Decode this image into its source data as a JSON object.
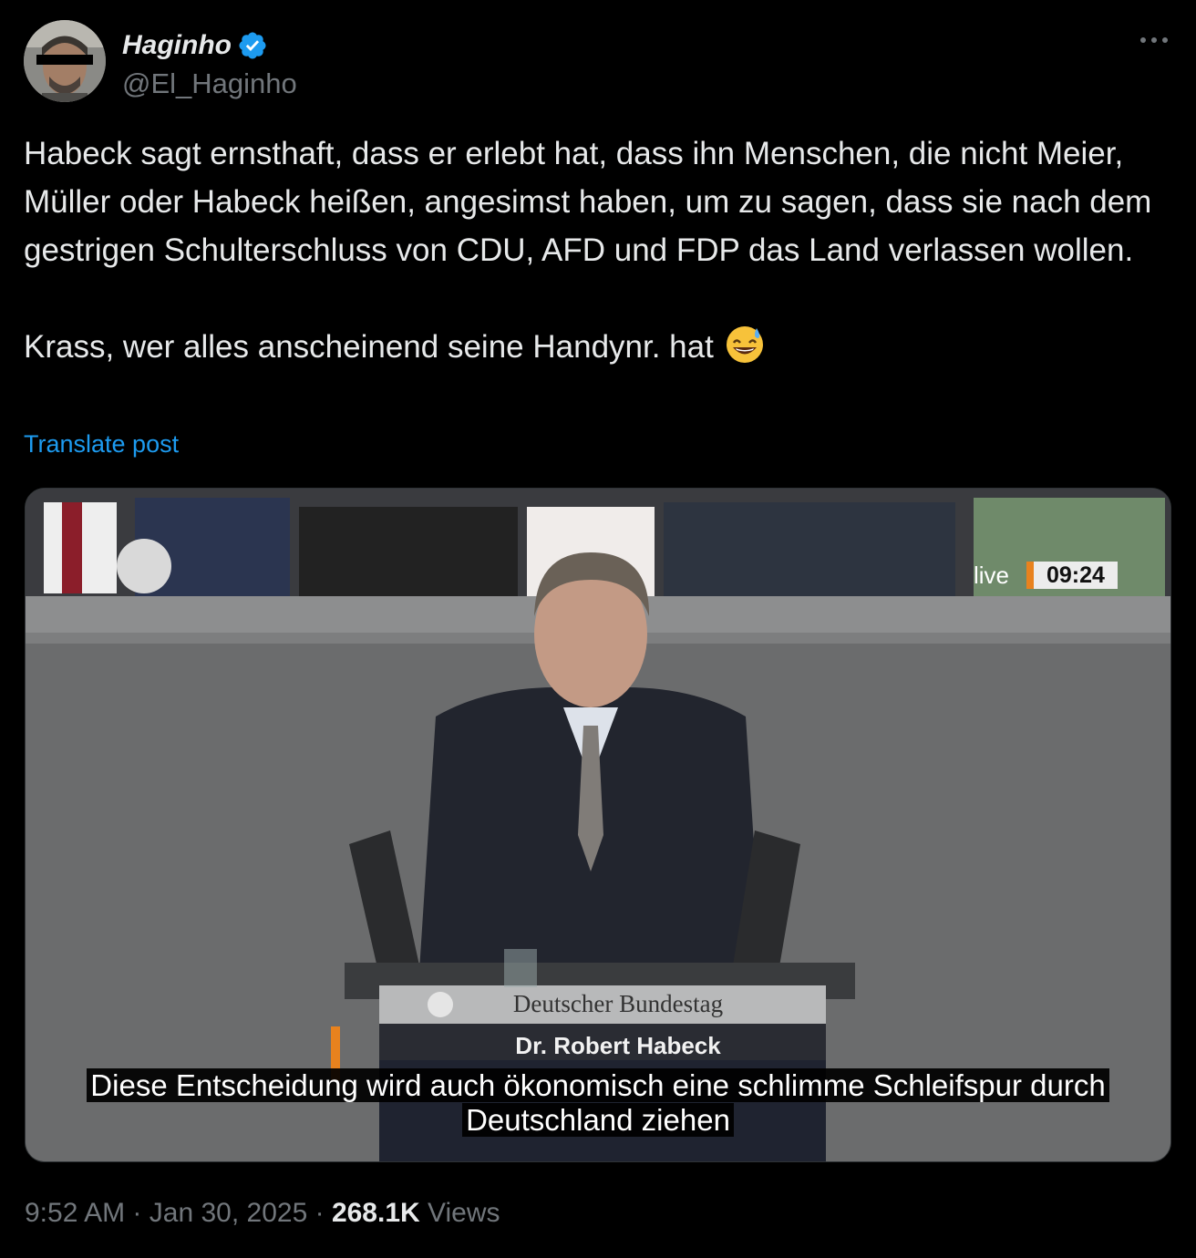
{
  "author": {
    "display_name": "Haginho",
    "handle": "@El_Haginho",
    "verified": true,
    "avatar_icon": "avatar-photo",
    "more_icon": "more-horizontal-icon"
  },
  "post": {
    "text": "Habeck sagt ernsthaft, dass er erlebt hat, dass ihn Menschen, die nicht Meier, Müller oder Habeck heißen, angesimst haben, um zu sagen, dass sie nach dem gestrigen Schulterschluss von CDU, AFD und FDP das Land verlassen wollen.\n\nKrass, wer alles anscheinend seine Handynr. hat",
    "emoji": "grinning-face-with-sweat-icon",
    "translate_label": "Translate post"
  },
  "video": {
    "live_label": "live",
    "live_time": "09:24",
    "lectern_title": "Deutscher Bundestag",
    "lectern_name": "Dr. Robert Habeck",
    "caption_line1": "Diese Entscheidung wird auch ökonomisch eine schlimme Schleifspur durch",
    "caption_line2": "Deutschland ziehen"
  },
  "meta": {
    "time": "9:52 AM",
    "separator": "·",
    "date": "Jan 30, 2025",
    "views_count": "268.1K",
    "views_label": "Views"
  },
  "colors": {
    "background": "#000000",
    "text": "#e7e9ea",
    "muted": "#71767b",
    "link": "#1d9bf0",
    "verified": "#1d9bf0"
  }
}
